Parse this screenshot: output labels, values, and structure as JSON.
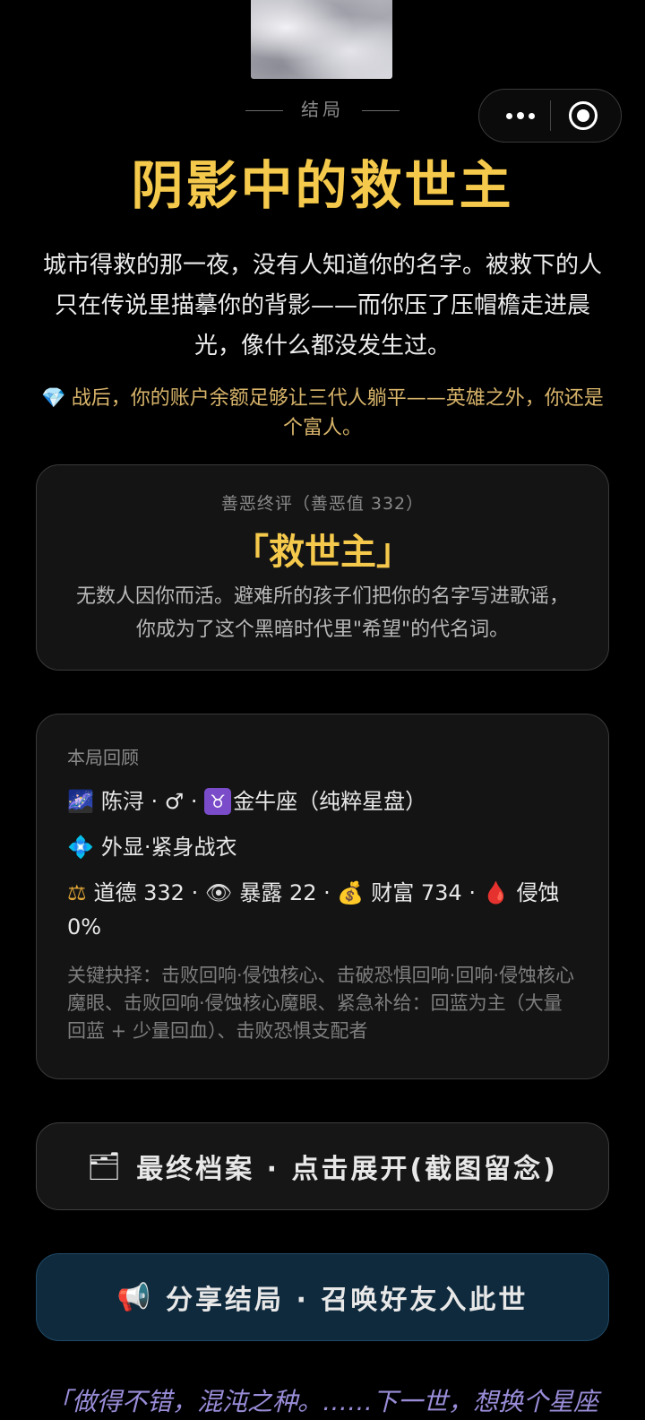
{
  "capsule": {
    "more_icon": "more-dots-icon",
    "close_icon": "target-close-icon"
  },
  "header": {
    "section_label": "结局",
    "title": "阴影中的救世主",
    "description": "城市得救的那一夜，没有人知道你的名字。被救下的人只在传说里描摹你的背影——而你压了压帽檐走进晨光，像什么都没发生过。",
    "wealth_icon": "💎",
    "wealth_note": "战后，你的账户余额足够让三代人躺平——英雄之外，你还是个富人。"
  },
  "verdict": {
    "label": "善恶终评（善恶值 332）",
    "title": "「救世主」",
    "description": "无数人因你而活。避难所的孩子们把你的名字写进歌谣，你成为了这个黑暗时代里\"希望\"的代名词。"
  },
  "review": {
    "heading": "本局回顾",
    "identity_icon": "🌌",
    "identity": "陈浔 · ♂ · ",
    "zodiac_icon": "♉",
    "zodiac": "金牛座（纯粹星盘）",
    "appearance_icon": "💠",
    "appearance": "外显·紧身战衣",
    "stats": {
      "morality_icon": "⚖",
      "morality": "道德 332 · ",
      "exposure_icon": "👁",
      "exposure": "暴露 22 · ",
      "wealth_icon": "💰",
      "wealth": "财富 734 · ",
      "corrosion_icon": "🩸",
      "corrosion": "侵蚀 0%"
    },
    "key_choices": "关键抉择：击败回响·侵蚀核心、击破恐惧回响·回响·侵蚀核心魔眼、击败回响·侵蚀核心魔眼、紧急补给：回蓝为主（大量回蓝 + 少量回血）、击败恐惧支配者"
  },
  "buttons": {
    "archive_icon": "🗂",
    "archive_label": "最终档案 · 点击展开(截图留念)",
    "share_icon": "📢",
    "share_label": "分享结局 · 召唤好友入此世"
  },
  "footer": {
    "quote": "「做得不错，混沌之种。……下一世，想换个星座"
  },
  "colors": {
    "accent": "#f5c94b",
    "wealth": "#d8b46a",
    "share_bg": "#0f2a3d",
    "footer": "#9a8cd8"
  }
}
